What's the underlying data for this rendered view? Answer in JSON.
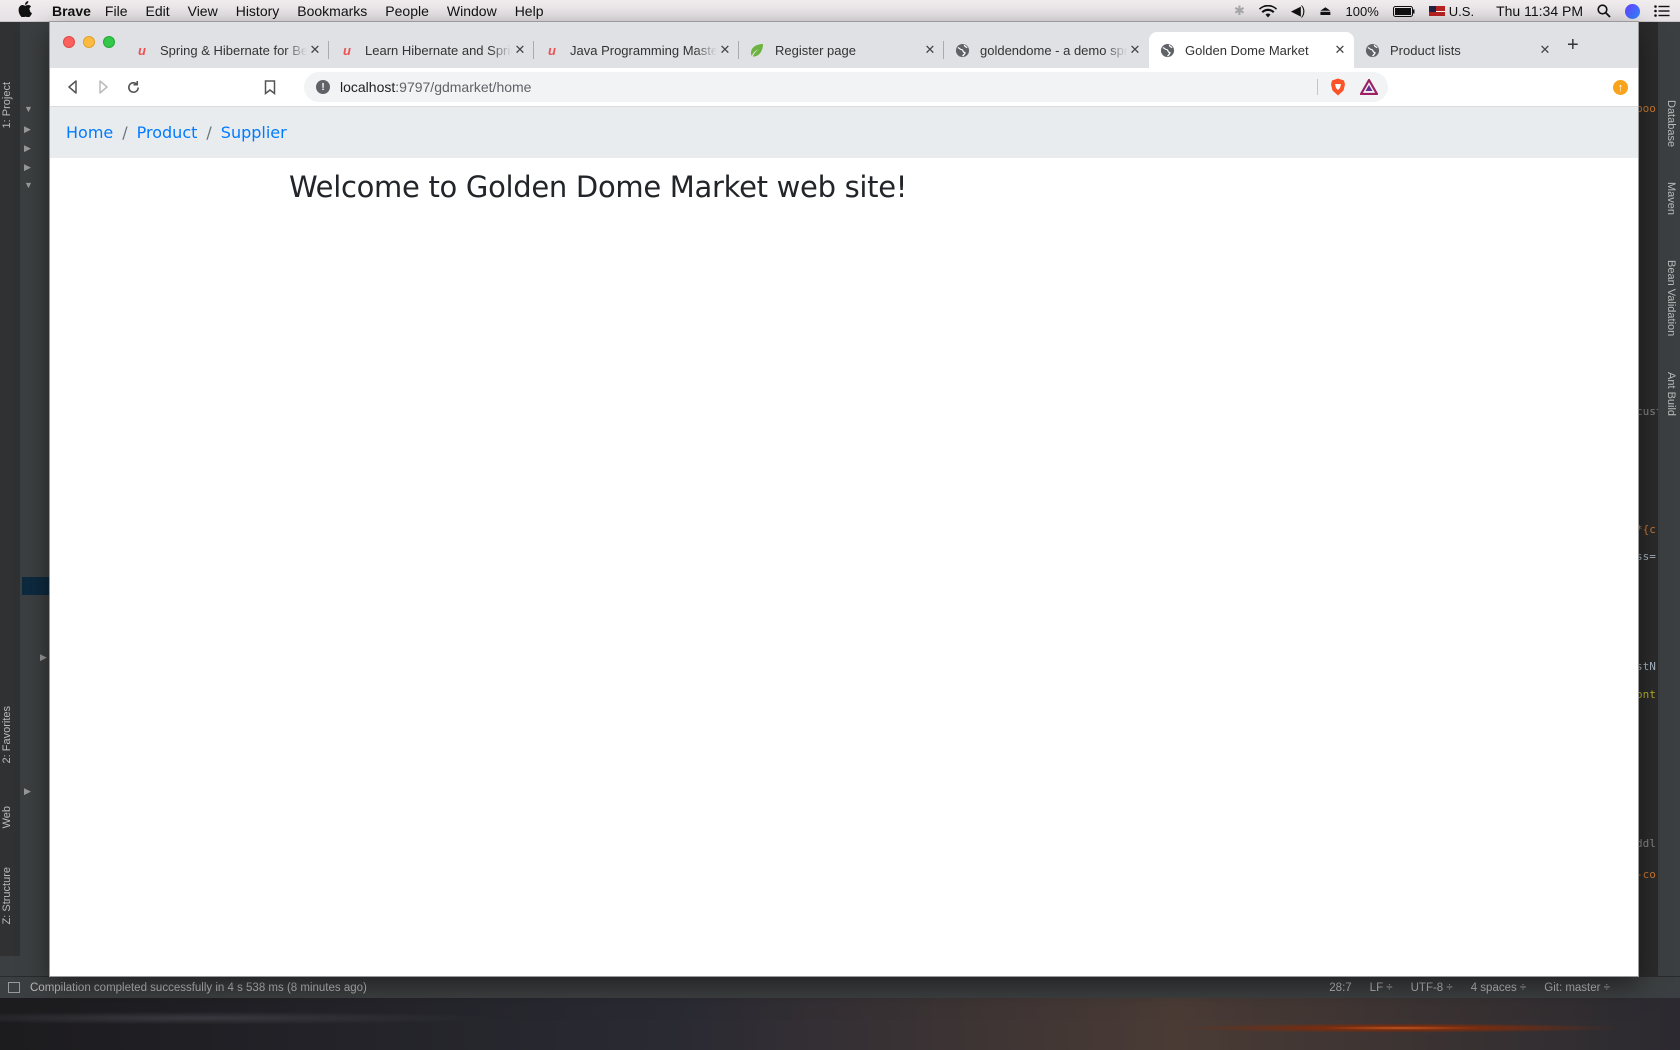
{
  "menubar": {
    "app_name": "Brave",
    "menus": [
      "File",
      "Edit",
      "View",
      "History",
      "Bookmarks",
      "People",
      "Window",
      "Help"
    ],
    "battery": "100%",
    "input_source": "U.S.",
    "clock": "Thu 11:34 PM"
  },
  "browser": {
    "tabs": [
      {
        "title": "Spring & Hibernate for Beginners",
        "icon": "udemy-icon"
      },
      {
        "title": "Learn Hibernate and Spring",
        "icon": "udemy-icon"
      },
      {
        "title": "Java Programming Masterclass",
        "icon": "udemy-icon"
      },
      {
        "title": "Register page",
        "icon": "spring-leaf-icon"
      },
      {
        "title": "goldendome - a demo spring",
        "icon": "globe-icon"
      },
      {
        "title": "Golden Dome Market",
        "icon": "globe-icon",
        "active": true
      },
      {
        "title": "Product lists",
        "icon": "globe-icon"
      }
    ],
    "new_tab": "+",
    "url_host": "localhost",
    "url_path": ":9797/gdmarket/home"
  },
  "page": {
    "breadcrumb": [
      "Home",
      "Product",
      "Supplier"
    ],
    "separator": "/",
    "heading": "Welcome to Golden Dome Market web site!"
  },
  "ide": {
    "left_tabs": [
      "1: Project",
      "2: Favorites",
      "Web",
      "Z: Structure"
    ],
    "right_tabs": [
      "Database",
      "Maven",
      "Bean Validation",
      "Ant Build"
    ],
    "status_message": "Compilation completed successfully in 4 s 538 ms (8 minutes ago)",
    "status_right": [
      "28:7",
      "LF ÷",
      "UTF-8 ÷",
      "4 spaces ÷",
      "Git: master ÷"
    ],
    "code_fragments": [
      "boo",
      "cust",
      "*{c",
      "ss=",
      "stN",
      "ont",
      "ddl",
      "-co"
    ]
  },
  "colors": {
    "link": "#007bff",
    "breadcrumb_bg": "#e9ecef",
    "heading": "#212529"
  }
}
